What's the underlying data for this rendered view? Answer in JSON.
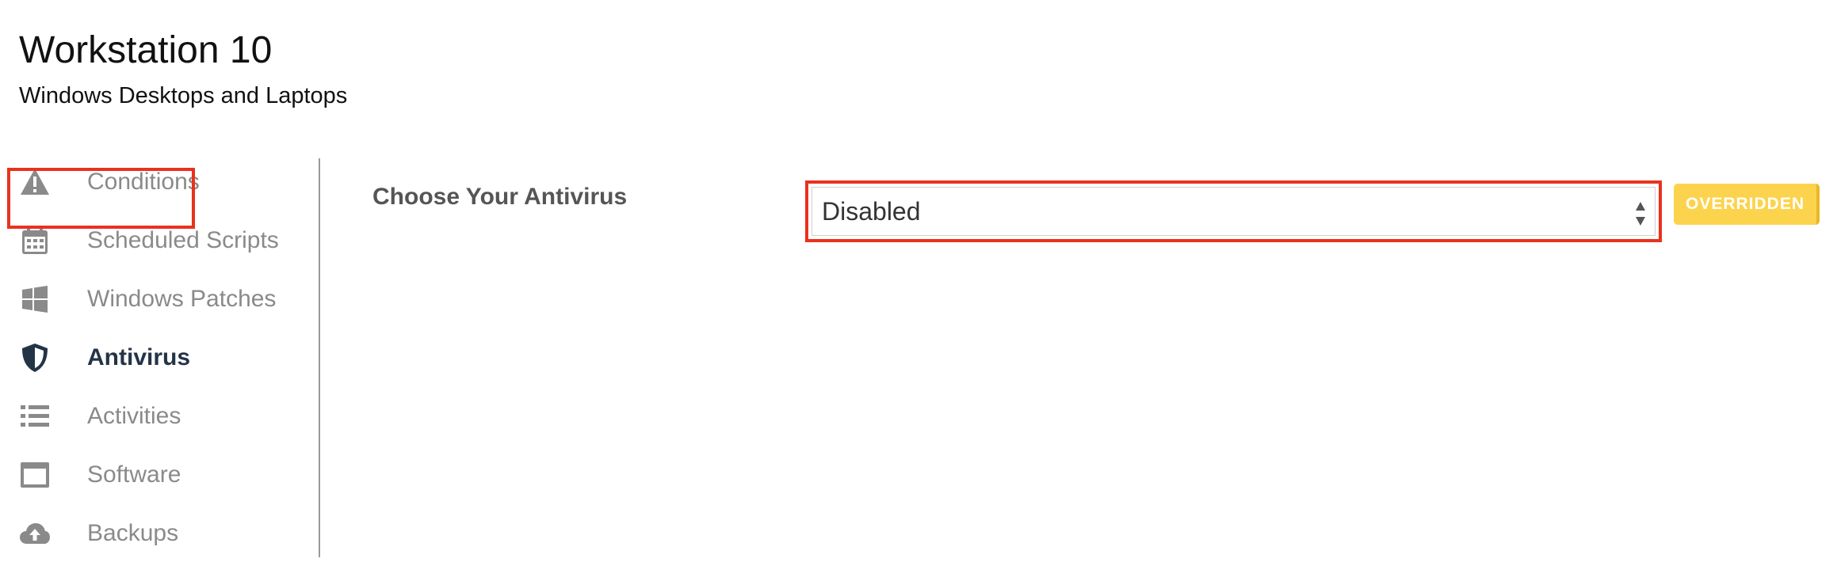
{
  "header": {
    "title": "Workstation 10",
    "subtitle": "Windows Desktops and Laptops"
  },
  "sidebar": {
    "items": [
      {
        "label": "Conditions",
        "icon": "warning-icon"
      },
      {
        "label": "Scheduled Scripts",
        "icon": "calendar-icon"
      },
      {
        "label": "Windows Patches",
        "icon": "windows-icon"
      },
      {
        "label": "Antivirus",
        "icon": "shield-icon",
        "active": true
      },
      {
        "label": "Activities",
        "icon": "list-icon"
      },
      {
        "label": "Software",
        "icon": "window-icon"
      },
      {
        "label": "Backups",
        "icon": "cloud-upload-icon"
      }
    ]
  },
  "main": {
    "field_label": "Choose Your Antivirus",
    "select_value": "Disabled",
    "override_label": "OVERRIDDEN"
  },
  "colors": {
    "highlight": "#e8321e",
    "override": "#fcd34d",
    "icon_gray": "#8a8a8a",
    "active_text": "#243447"
  }
}
